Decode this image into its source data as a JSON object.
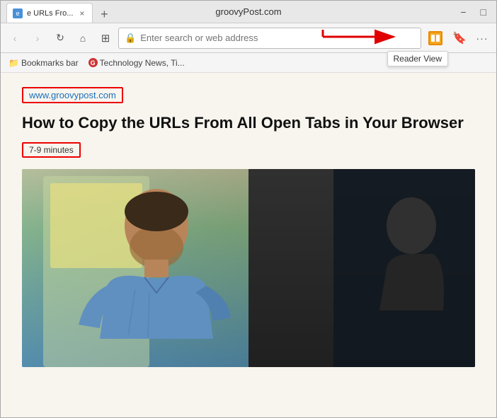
{
  "browser": {
    "title": "groovyPost.com",
    "tab": {
      "title": "e URLs Fro...",
      "close_label": "×"
    },
    "new_tab_label": "+",
    "window_controls": {
      "minimize": "−",
      "maximize": "□",
      "restore": "❐"
    }
  },
  "nav": {
    "address_placeholder": "Enter search or web address",
    "address_icon": "🔒",
    "reader_view_tooltip": "Reader View",
    "nav_back": "‹",
    "nav_forward": "›",
    "refresh": "↻",
    "home": "⌂",
    "grid_icon": "⊞"
  },
  "bookmarks": {
    "label": "Bookmarks bar",
    "items": [
      {
        "label": "Technology News, Ti...",
        "icon": "G"
      }
    ]
  },
  "page": {
    "url": "www.groovypost.com",
    "title": "How to Copy the URLs From All Open Tabs in Your Browser",
    "read_time": "7-9 minutes"
  },
  "toolbar": {
    "collections_icon": "🔖",
    "menu_icon": "···",
    "sidebar_icon": "⊞"
  },
  "arrow": {
    "tooltip": "Reader View"
  }
}
